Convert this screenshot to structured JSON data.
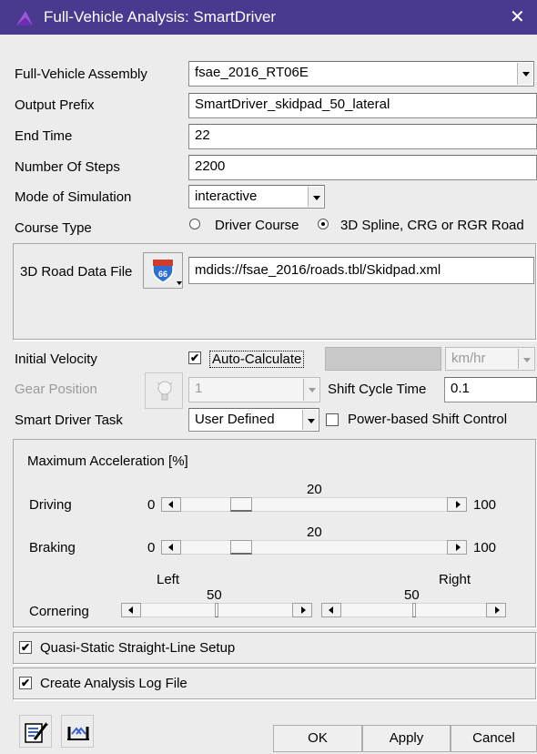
{
  "window": {
    "title": "Full-Vehicle Analysis: SmartDriver",
    "close_glyph": "✕"
  },
  "form": {
    "assembly": {
      "label": "Full-Vehicle Assembly",
      "value": "fsae_2016_RT06E"
    },
    "output_prefix": {
      "label": "Output Prefix",
      "value": "SmartDriver_skidpad_50_lateral"
    },
    "end_time": {
      "label": "End Time",
      "value": "22"
    },
    "num_steps": {
      "label": "Number Of Steps",
      "value": "2200"
    },
    "mode": {
      "label": "Mode of Simulation",
      "value": "interactive"
    },
    "course_type": {
      "label": "Course Type",
      "options": [
        "Driver Course",
        "3D Spline, CRG or RGR Road"
      ],
      "selected": 1
    },
    "road_file": {
      "label": "3D Road Data File",
      "value": "mdids://fsae_2016/roads.tbl/Skidpad.xml",
      "icon_badge": "66"
    },
    "initial_velocity": {
      "label": "Initial Velocity",
      "auto_label": "Auto-Calculate",
      "auto_checked": true,
      "value": "",
      "unit": "km/hr"
    },
    "gear": {
      "label": "Gear Position",
      "value": "1"
    },
    "shift_cycle": {
      "label": "Shift Cycle Time",
      "value": "0.1"
    },
    "task": {
      "label": "Smart Driver Task",
      "value": "User Defined",
      "power_shift_label": "Power-based Shift Control",
      "power_shift_checked": false
    },
    "max_accel": {
      "title": "Maximum Acceleration [%]",
      "driving": {
        "label": "Driving",
        "min": "0",
        "max": "100",
        "value": "20",
        "fraction": 0.2
      },
      "braking": {
        "label": "Braking",
        "min": "0",
        "max": "100",
        "value": "20",
        "fraction": 0.2
      },
      "cornering": {
        "label": "Cornering",
        "left_label": "Left",
        "right_label": "Right",
        "left_value": "50",
        "right_value": "50",
        "left_fraction": 0.5,
        "right_fraction": 0.5
      }
    },
    "quasi_static": {
      "label": "Quasi-Static Straight-Line Setup",
      "checked": true
    },
    "log_file": {
      "label": "Create Analysis Log File",
      "checked": true
    }
  },
  "buttons": {
    "ok": "OK",
    "apply": "Apply",
    "cancel": "Cancel"
  },
  "check_glyph": "✔",
  "colors": {
    "titlebar": "#49398f",
    "road_icon_shield": "#2f6fd1",
    "road_icon_top": "#d23b2b"
  }
}
